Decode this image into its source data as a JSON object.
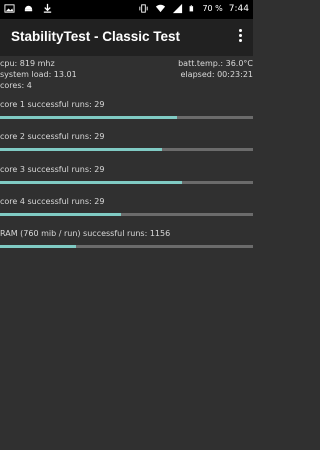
{
  "status_bar": {
    "battery": "70 %",
    "time": "7:44",
    "left_icons": [
      "image-icon",
      "android-icon",
      "download-icon"
    ],
    "right_icons": [
      "vibrate-icon",
      "wifi-icon",
      "signal-icon",
      "battery-icon"
    ]
  },
  "app_bar": {
    "title": "StabilityTest - Classic Test",
    "menu_icon": "overflow-menu-icon"
  },
  "info": {
    "cpu": "cpu: 819 mhz",
    "batt_temp": "batt.temp.: 36.0°C",
    "system_load": "system load: 13.01",
    "elapsed": "elapsed: 00:23:21",
    "cores": "cores: 4"
  },
  "tests": [
    {
      "label": "core 1 successful runs: 29",
      "progress": 0.7
    },
    {
      "label": "core 2 successful runs: 29",
      "progress": 0.64
    },
    {
      "label": "core 3 successful runs: 29",
      "progress": 0.72
    },
    {
      "label": "core 4 successful runs: 29",
      "progress": 0.48
    },
    {
      "label": "RAM (760 mib / run) successful runs: 1156",
      "progress": 0.3
    }
  ],
  "colors": {
    "background": "#303030",
    "app_bar": "#212121",
    "progress_fill": "#80cbc4",
    "progress_track": "#6b6b6b"
  }
}
